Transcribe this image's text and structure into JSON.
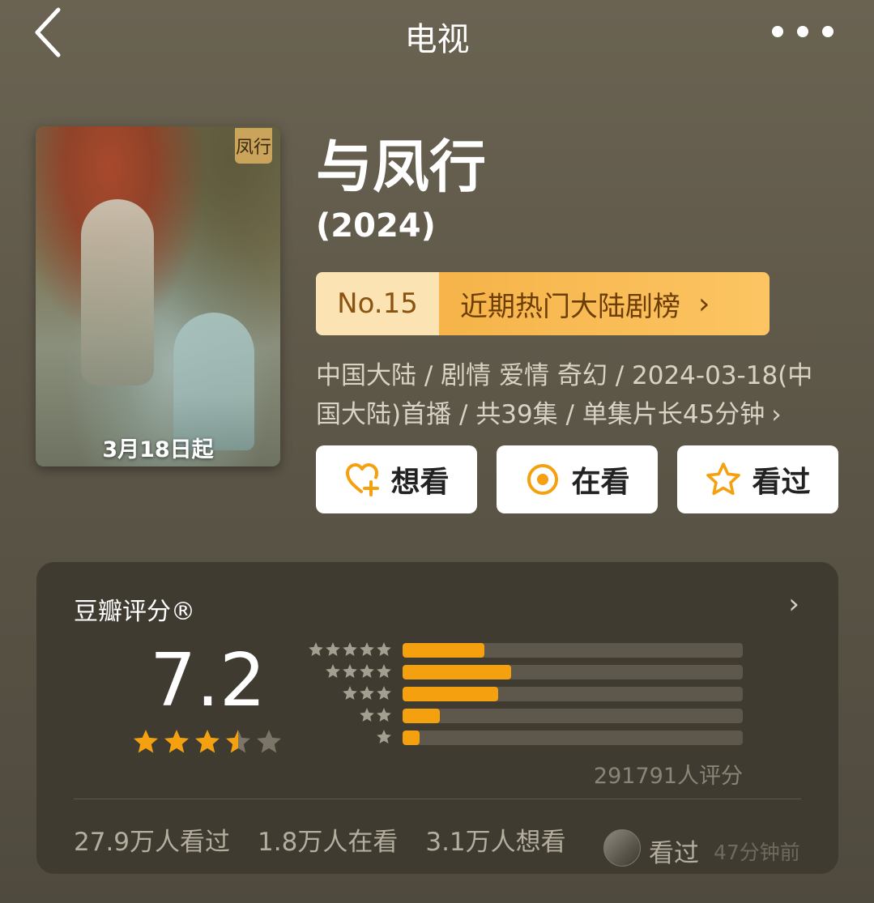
{
  "header": {
    "title": "电视"
  },
  "poster": {
    "badge": "凤行",
    "caption": "3月18日起"
  },
  "show": {
    "title": "与凤行",
    "year": "(2024)"
  },
  "ranking": {
    "number": "No.15",
    "list_name": "近期热门大陆剧榜",
    "chevron": "›"
  },
  "meta": {
    "text": "中国大陆 / 剧情 爱情 奇幻 / 2024-03-18(中国大陆)首播 / 共39集 / 单集片长45分钟",
    "chevron": "›"
  },
  "actions": [
    {
      "label": "想看",
      "icon": "heart-plus-icon"
    },
    {
      "label": "在看",
      "icon": "target-circle-icon"
    },
    {
      "label": "看过",
      "icon": "star-outline-icon"
    }
  ],
  "rating": {
    "label": "豆瓣评分®",
    "chevron": "›",
    "score": "7.2",
    "star_value": 3.5,
    "star_color": "#f5a00e",
    "empty_star_color": "#7a7566",
    "distribution": [
      {
        "stars": 5,
        "fraction": 0.24
      },
      {
        "stars": 4,
        "fraction": 0.32
      },
      {
        "stars": 3,
        "fraction": 0.28
      },
      {
        "stars": 2,
        "fraction": 0.11
      },
      {
        "stars": 1,
        "fraction": 0.05
      }
    ],
    "raters": "291791人评分"
  },
  "stats": {
    "watched": "27.9万人看过",
    "watching": "1.8万人在看",
    "want": "3.1万人想看"
  },
  "recent": {
    "label": "看过",
    "time": "47分钟前"
  },
  "colors": {
    "accent": "#f5a00e",
    "background": "#5f594a",
    "card": "#403b30"
  }
}
